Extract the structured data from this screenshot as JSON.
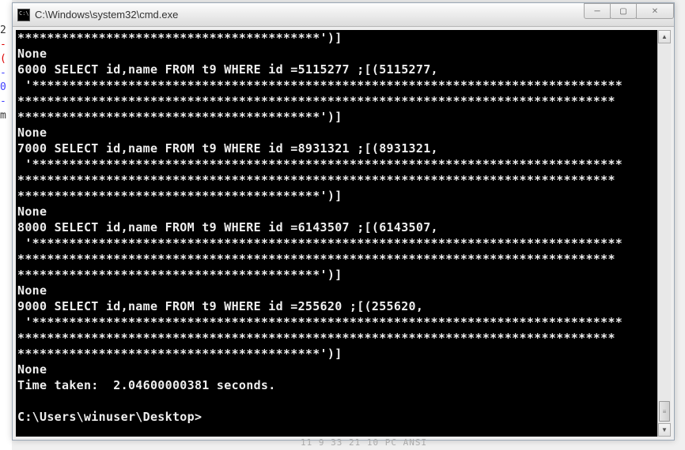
{
  "window": {
    "title": "C:\\Windows\\system32\\cmd.exe"
  },
  "controls": {
    "minimize": "─",
    "maximize": "▢",
    "close": "✕"
  },
  "left_edge": {
    "l1": "2",
    "l2": "-",
    "l3": "(",
    "l4": "-",
    "l5": "0",
    "l6": "-",
    "l7": "m"
  },
  "console_lines": [
    "*****************************************')]",
    "None",
    "6000 SELECT id,name FROM t9 WHERE id =5115277 ;[(5115277,",
    " '********************************************************************************",
    "*********************************************************************************",
    "*****************************************')]",
    "None",
    "7000 SELECT id,name FROM t9 WHERE id =8931321 ;[(8931321,",
    " '********************************************************************************",
    "*********************************************************************************",
    "*****************************************')]",
    "None",
    "8000 SELECT id,name FROM t9 WHERE id =6143507 ;[(6143507,",
    " '********************************************************************************",
    "*********************************************************************************",
    "*****************************************')]",
    "None",
    "9000 SELECT id,name FROM t9 WHERE id =255620 ;[(255620,",
    " '********************************************************************************",
    "*********************************************************************************",
    "*****************************************')]",
    "None",
    "Time taken:  2.04600000381 seconds.",
    "",
    "C:\\Users\\winuser\\Desktop>"
  ],
  "bottom_hint": "11     9 33        21        10     PC      ANSI"
}
